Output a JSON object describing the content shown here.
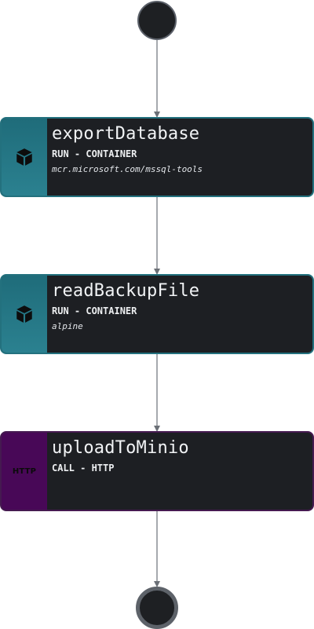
{
  "colors": {
    "node_background": "#1d1f23",
    "run_accent": "#23717e",
    "call_accent": "#480857",
    "edge": "#6b7077",
    "terminal_border": "#5d6269"
  },
  "nodes": [
    {
      "name": "exportDatabase",
      "type": "RUN - CONTAINER",
      "image": "mcr.microsoft.com/mssql-tools",
      "icon": "cube-icon"
    },
    {
      "name": "readBackupFile",
      "type": "RUN - CONTAINER",
      "image": "alpine",
      "icon": "cube-icon"
    },
    {
      "name": "uploadToMinio",
      "type": "CALL - HTTP",
      "icon": "http-icon",
      "icon_text": "HTTP"
    }
  ]
}
